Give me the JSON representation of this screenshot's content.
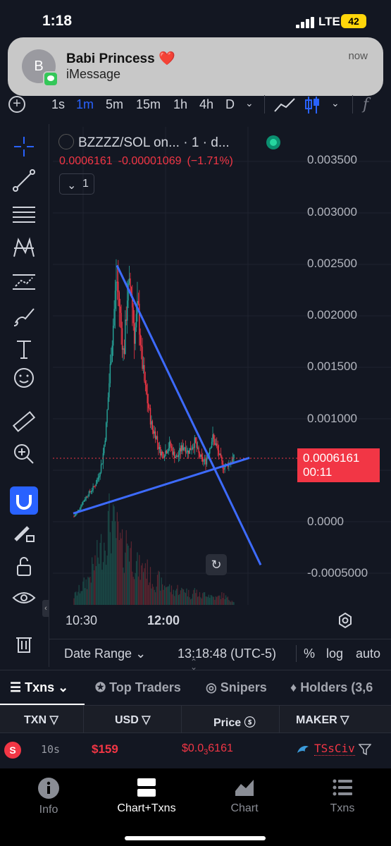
{
  "status_bar": {
    "time": "1:18",
    "network": "LTE",
    "battery": "42"
  },
  "notification": {
    "avatar_letter": "B",
    "title": "Babi Princess ❤️",
    "body": "iMessage",
    "time": "now"
  },
  "toolbar": {
    "timeframes": [
      "1s",
      "1m",
      "5m",
      "15m",
      "1h",
      "4h",
      "D"
    ],
    "active_timeframe": "1m",
    "fx": "f"
  },
  "legend": {
    "symbol": "BZZZZ/SOL on...",
    "interval": "· 1 · d...",
    "last": "0.0006161",
    "change": "-0.00001069",
    "change_pct": "(−1.71%)",
    "collapse_count": "1"
  },
  "chart_data": {
    "type": "candlestick",
    "y_ticks": [
      "0.003500",
      "0.003000",
      "0.002500",
      "0.002000",
      "0.001500",
      "0.001000",
      "0.0000",
      "-0.0005000"
    ],
    "x_ticks": [
      "10:30",
      "12:00"
    ],
    "last_price": "0.0006161",
    "countdown": "00:11",
    "ylim": [
      -0.00055,
      0.0036
    ],
    "price_path": [
      5e-05,
      0.0001,
      0.00016,
      0.00022,
      0.00027,
      0.00031,
      0.00036,
      0.00045,
      0.0006,
      0.0009,
      0.0014,
      0.0019,
      0.0024,
      0.002,
      0.0016,
      0.0022,
      0.0023,
      0.0018,
      0.0021,
      0.0016,
      0.0013,
      0.0011,
      0.0009,
      0.00085,
      0.0007,
      0.00065,
      0.0007,
      0.00075,
      0.00066,
      0.00062,
      0.0007,
      0.00074,
      0.00068,
      0.00072,
      0.00078,
      0.00066,
      0.0006,
      0.00058,
      0.0007,
      0.00082,
      0.00074,
      0.00063,
      0.00053,
      0.00055,
      0.00058,
      0.0006161
    ],
    "volume_path": [
      0.1,
      0.15,
      0.2,
      0.25,
      0.3,
      0.4,
      0.5,
      0.6,
      0.7,
      0.8,
      1.0,
      0.9,
      0.85,
      0.7,
      0.6,
      0.8,
      0.65,
      0.5,
      0.45,
      0.4,
      0.5,
      0.35,
      0.3,
      0.25,
      0.3,
      0.2,
      0.25,
      0.2,
      0.15,
      0.2,
      0.15,
      0.2,
      0.15,
      0.1,
      0.18,
      0.12,
      0.1,
      0.15,
      0.12,
      0.1,
      0.08,
      0.1,
      0.12,
      0.08,
      0.06,
      0.05
    ],
    "trendlines": [
      {
        "name": "resistance",
        "from": [
          0.0,
          0.00249
        ],
        "to": [
          1.0,
          -0.00042
        ]
      },
      {
        "name": "support",
        "from": [
          0.0,
          8e-05
        ],
        "to": [
          1.0,
          0.00062
        ]
      }
    ]
  },
  "chart_footer": {
    "date_range": "Date Range",
    "clock": "13:18:48 (UTC-5)",
    "pct": "%",
    "log": "log",
    "auto": "auto"
  },
  "txn_tabs": [
    "Txns",
    "Top Traders",
    "Snipers",
    "Holders (3,6"
  ],
  "txn_columns": [
    "TXN",
    "USD",
    "Price",
    "MAKER"
  ],
  "txn_rows": [
    {
      "side": "S",
      "age": "10s",
      "usd": "$159",
      "price_prefix": "$0.0",
      "price_zeros": "3",
      "price_digits": "6161",
      "maker": "TSsCiv"
    }
  ],
  "bottom_nav": [
    "Info",
    "Chart+Txns",
    "Chart",
    "Txns"
  ],
  "colors": {
    "accent": "#2962ff",
    "down": "#f23645",
    "up": "#26a69a",
    "bg": "#131722"
  }
}
